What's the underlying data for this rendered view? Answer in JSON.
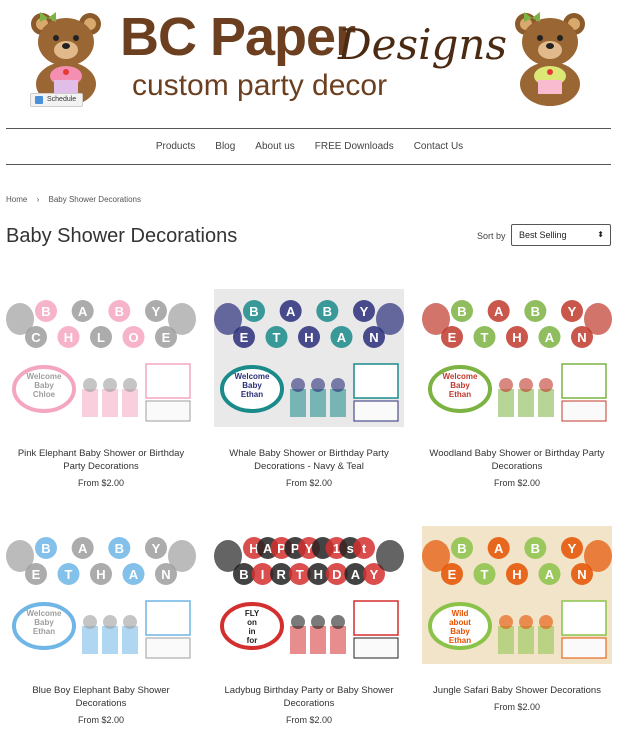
{
  "header": {
    "logo_title": "BC Paper",
    "logo_designs": "Designs",
    "logo_sub": "custom party decor",
    "schedule_label": "Schedule"
  },
  "nav": {
    "items": [
      "Products",
      "Blog",
      "About us",
      "FREE Downloads",
      "Contact Us"
    ]
  },
  "breadcrumb": {
    "home": "Home",
    "separator": "›",
    "current": "Baby Shower Decorations"
  },
  "page": {
    "title": "Baby Shower Decorations",
    "sort_label": "Sort by",
    "sort_value": "Best Selling"
  },
  "products": [
    {
      "name": "Pink Elephant Baby Shower or Birthday Party Decorations",
      "price": "From $2.00",
      "banner_top": "BABY",
      "banner_bottom": "CHLOE",
      "badge": "Welcome Baby Chloe",
      "accent": "#f4a6c1",
      "accent2": "#9e9e9e",
      "bg": "#ffffff"
    },
    {
      "name": "Whale Baby Shower or Birthday Party Decorations - Navy & Teal",
      "price": "From $2.00",
      "banner_top": "BABY",
      "banner_bottom": "ETHAN",
      "badge": "Welcome Baby Ethan",
      "accent": "#1a8a8a",
      "accent2": "#2b2f7a",
      "bg": "#e9e9e9"
    },
    {
      "name": "Woodland Baby Shower or Birthday Party Decorations",
      "price": "From $2.00",
      "banner_top": "BABY",
      "banner_bottom": "ETHAN",
      "badge": "Welcome Baby Ethan",
      "accent": "#7cb342",
      "accent2": "#c0392b",
      "bg": "#ffffff"
    },
    {
      "name": "Blue Boy Elephant Baby Shower Decorations",
      "price": "From $2.00",
      "banner_top": "BABY",
      "banner_bottom": "ETHAN",
      "badge": "Welcome Baby Ethan",
      "accent": "#6fb6e6",
      "accent2": "#9e9e9e",
      "bg": "#ffffff"
    },
    {
      "name": "Ladybug Birthday Party or Baby Shower Decorations",
      "price": "From $2.00",
      "banner_top": "HAPPY 1st",
      "banner_bottom": "BIRTHDAY",
      "badge": "FLY on in for Elise's Birthday!",
      "accent": "#d32f2f",
      "accent2": "#222222",
      "bg": "#ffffff"
    },
    {
      "name": "Jungle Safari Baby Shower Decorations",
      "price": "From $2.00",
      "banner_top": "BABY",
      "banner_bottom": "ETHAN",
      "badge": "Wild about Baby Ethan",
      "accent": "#8bc34a",
      "accent2": "#e65100",
      "bg": "#f1e4c8"
    }
  ]
}
